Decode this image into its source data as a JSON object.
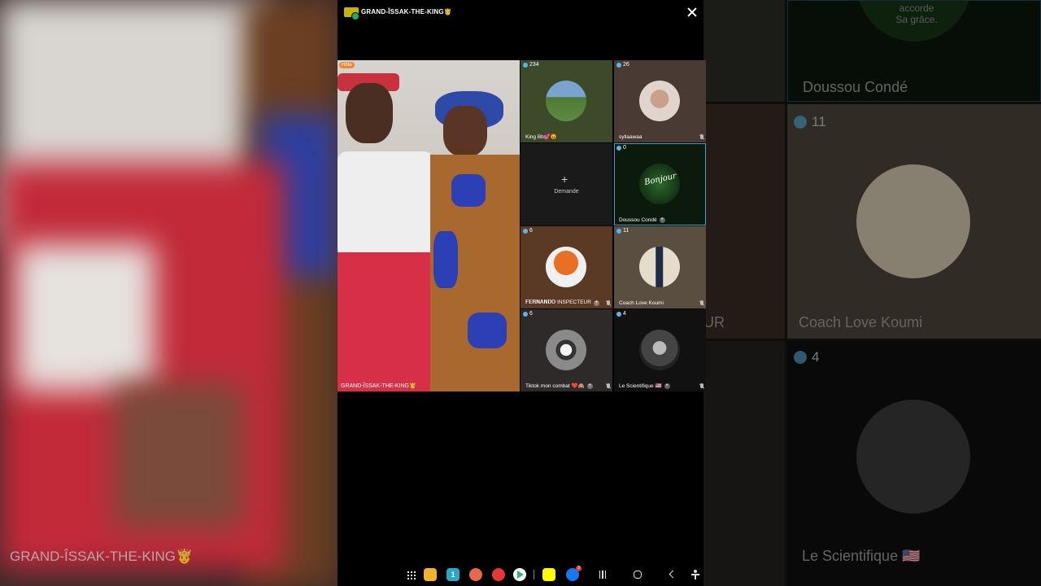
{
  "host": {
    "title": "GRAND-ÎSSAK-THE-KING🤴",
    "badge": "Hôte",
    "video_name": "GRAND-ÎSSAK-THE-KING🤴"
  },
  "tiles": [
    {
      "count": "234",
      "name": "King Bb💕😡",
      "bg": "#3d4a2a",
      "avatar_bg": "#5f8a44",
      "muted": false,
      "addable": false
    },
    {
      "count": "26",
      "name": "syllaawaa",
      "bg": "#4a3a34",
      "avatar_bg": "#c9b1a6",
      "muted": true,
      "addable": false
    },
    {
      "type": "request",
      "label": "Demande",
      "plus": "+"
    },
    {
      "count": "0",
      "name": "Doussou Condé",
      "bg": "#0b1a0b",
      "avatar_bg": "#1e4d1e",
      "muted": false,
      "addable": true,
      "selected": true,
      "avatar_text": "Bonjour"
    },
    {
      "count": "6",
      "name": "𝐅𝐄𝐑𝐍𝐀𝐍𝐃𝐎 INSPECTEUR",
      "bg": "#5a3a24",
      "avatar_bg": "#e0742a",
      "muted": true,
      "addable": true
    },
    {
      "count": "11",
      "name": "Coach Love Koumi",
      "bg": "#5a4e40",
      "avatar_bg": "#d8cdb8",
      "muted": true,
      "addable": false
    },
    {
      "count": "6",
      "name": "Tiktok mon combat ❤️🙈",
      "bg": "#2e2a2a",
      "avatar_bg": "#9a9a9a",
      "muted": true,
      "addable": true
    },
    {
      "count": "4",
      "name": "Le Scientifique 🇺🇸",
      "bg": "#111111",
      "avatar_bg": "#555555",
      "muted": true,
      "addable": true
    }
  ],
  "side_right": {
    "top_name": "Doussou Condé",
    "top_text": "accorde Sa grâce.",
    "mid_count": "11",
    "mid_name": "Coach Love Koumi",
    "mid_left_fragment": "UR",
    "bottom_count": "4",
    "bottom_name": "Le Scientifique 🇺🇸"
  },
  "side_left": {
    "name": "GRAND-ÎSSAK-THE-KING🤴"
  },
  "navbar": {
    "apps": [
      {
        "name": "files-app-icon",
        "color": "#f2b230"
      },
      {
        "name": "calendar-app-icon",
        "color": "#2aa6c7",
        "label": "1"
      },
      {
        "name": "contacts-app-icon",
        "color": "#e8684a"
      },
      {
        "name": "youtube-app-icon",
        "color": "#e53935"
      },
      {
        "name": "play-store-app-icon",
        "color": "#ffffff"
      },
      {
        "name": "snapchat-app-icon",
        "color": "#fffc00"
      },
      {
        "name": "facebook-app-icon",
        "color": "#1877f2",
        "badge": "3"
      }
    ]
  }
}
